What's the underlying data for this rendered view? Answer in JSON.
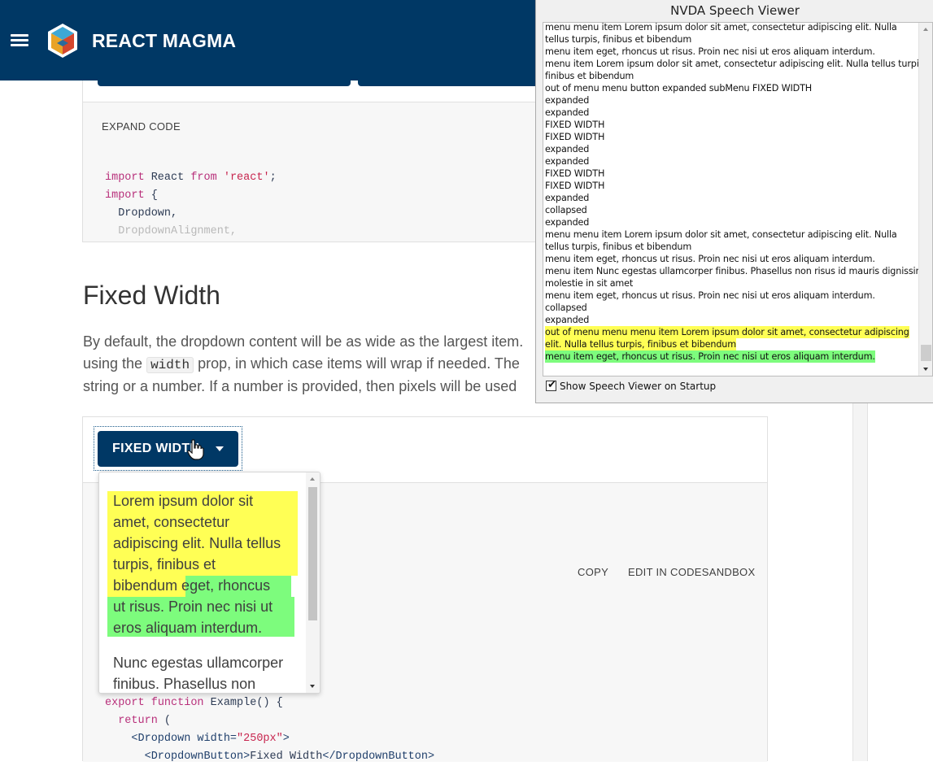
{
  "header": {
    "brand": "REACT MAGMA",
    "colors": {
      "bar": "#003865",
      "text": "#ffffff"
    }
  },
  "example_top": {
    "expand_code_label": "EXPAND CODE",
    "code_lines": [
      {
        "parts": [
          {
            "t": "import",
            "c": "kw"
          },
          {
            "t": " React ",
            "c": "plain"
          },
          {
            "t": "from",
            "c": "kw"
          },
          {
            "t": " ",
            "c": "plain"
          },
          {
            "t": "'react'",
            "c": "str"
          },
          {
            "t": ";",
            "c": "plain"
          }
        ]
      },
      {
        "parts": [
          {
            "t": "import",
            "c": "kw"
          },
          {
            "t": " {",
            "c": "plain"
          }
        ]
      },
      {
        "parts": [
          {
            "t": "  Dropdown,",
            "c": "plain"
          }
        ]
      },
      {
        "parts": [
          {
            "t": "  DropdownAlignment,",
            "c": "fade"
          }
        ]
      }
    ]
  },
  "section": {
    "title": "Fixed Width",
    "para_line1": "By default, the dropdown content will be as wide as the largest item.",
    "para_line2_pre": "using the ",
    "para_code": "width",
    "para_line2_post": " prop, in which case items will wrap if needed. The",
    "para_line3": "string or a number. If a number is provided, then pixels will be used"
  },
  "example_fixed": {
    "button_label": "FIXED WIDTH",
    "copy_label": "COPY",
    "sandbox_label": "EDIT IN CODESANDBOX",
    "dropdown_items": [
      [
        "Lorem ipsum dolor sit",
        "amet, consectetur",
        "adipiscing elit. Nulla tellus",
        "turpis, finibus et",
        "bibendum eget, rhoncus",
        "ut risus. Proin nec nisi ut",
        "eros aliquam interdum."
      ],
      [
        "Nunc egestas ullamcorper",
        "finibus. Phasellus non"
      ]
    ],
    "code_lines": [
      {
        "parts": [
          {
            "t": "export",
            "c": "kw"
          },
          {
            "t": " ",
            "c": "plain"
          },
          {
            "t": "function",
            "c": "kw"
          },
          {
            "t": " Example() {",
            "c": "plain"
          }
        ]
      },
      {
        "parts": [
          {
            "t": "  ",
            "c": "plain"
          },
          {
            "t": "return",
            "c": "kw"
          },
          {
            "t": " (",
            "c": "plain"
          }
        ]
      },
      {
        "parts": [
          {
            "t": "    <Dropdown ",
            "c": "tag"
          },
          {
            "t": "width=",
            "c": "tag"
          },
          {
            "t": "\"250px\"",
            "c": "str"
          },
          {
            "t": ">",
            "c": "tag"
          }
        ]
      },
      {
        "parts": [
          {
            "t": "      <DropdownButton>",
            "c": "tag"
          },
          {
            "t": "Fixed Width",
            "c": "plain"
          },
          {
            "t": "</DropdownButton>",
            "c": "tag"
          }
        ]
      }
    ],
    "highlight_colors": {
      "yellow": "#ffff55",
      "green": "#7dfc7d"
    }
  },
  "nvda": {
    "title": "NVDA Speech Viewer",
    "lines": [
      "menu    menu item    Lorem ipsum dolor sit amet, consectetur adipiscing elit. Nulla",
      "tellus turpis, finibus et bibendum",
      "menu item    eget, rhoncus ut risus. Proin nec nisi ut eros aliquam interdum.",
      "menu item    Lorem ipsum dolor sit amet, consectetur adipiscing elit. Nulla tellus turpis,",
      "finibus et bibendum",
      "out of menu  menu button  expanded  subMenu    FIXED WIDTH",
      "expanded",
      "expanded",
      "FIXED WIDTH",
      "FIXED WIDTH",
      "expanded",
      "expanded",
      "FIXED WIDTH",
      "FIXED WIDTH",
      "expanded",
      "collapsed",
      "expanded",
      "menu    menu item    Lorem ipsum dolor sit amet, consectetur adipiscing elit. Nulla",
      "tellus turpis, finibus et bibendum",
      "menu item    eget, rhoncus ut risus. Proin nec nisi ut eros aliquam interdum.",
      "menu item    Nunc egestas ullamcorper finibus. Phasellus non risus id mauris dignissim",
      "molestie in sit amet",
      "menu item    eget, rhoncus ut risus. Proin nec nisi ut eros aliquam interdum.",
      "collapsed",
      "expanded",
      "out of menu  menu    menu item    Lorem ipsum dolor sit amet, consectetur adipiscing",
      "elit. Nulla tellus turpis, finibus et bibendum",
      "menu item    eget, rhoncus ut risus. Proin nec nisi ut eros aliquam interdum."
    ],
    "highlight": {
      "yellow_lines": [
        25,
        26
      ],
      "green_lines": [
        27
      ]
    },
    "checkbox_label": "Show Speech Viewer on Startup",
    "checkbox_checked": true
  }
}
